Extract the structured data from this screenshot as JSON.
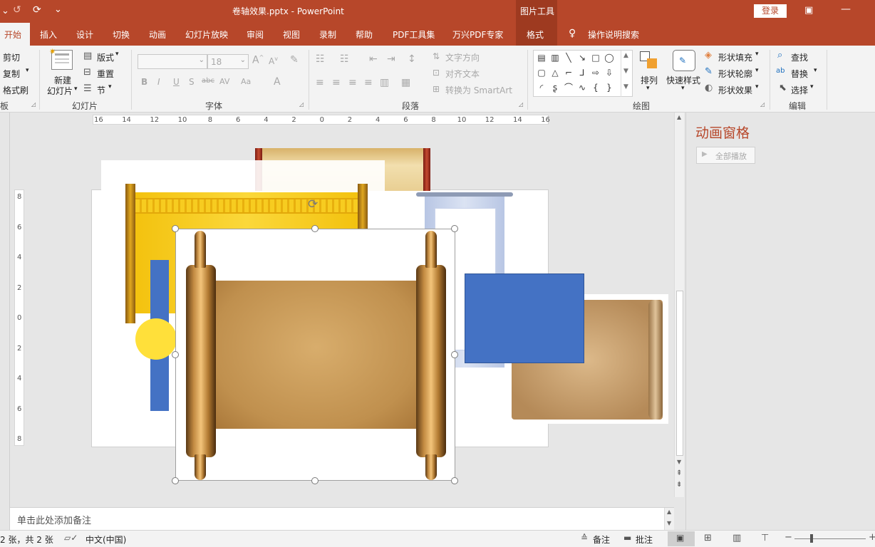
{
  "titlebar": {
    "quick_access": [
      "↺",
      "⟳",
      "⌄"
    ],
    "title": "卷轴效果.pptx  -  PowerPoint",
    "context_tab": "图片工具",
    "login": "登录"
  },
  "tabs": [
    "开始",
    "插入",
    "设计",
    "切换",
    "动画",
    "幻灯片放映",
    "审阅",
    "视图",
    "录制",
    "帮助",
    "PDF工具集",
    "万兴PDF专家",
    "格式"
  ],
  "tell_me": "操作说明搜索",
  "clipboard": {
    "cut": "剪切",
    "copy": "复制",
    "format_painter": "格式刷",
    "group_partial": "板"
  },
  "slides_group": {
    "new_slide": "新建",
    "new_slide2": "幻灯片",
    "layout": "版式",
    "reset": "重置",
    "section": "节",
    "title": "幻灯片"
  },
  "font_group": {
    "size": "18",
    "title": "字体",
    "bold": "B",
    "italic": "I",
    "underline": "U",
    "shadow": "S",
    "strike": "abc",
    "spacing": "AV",
    "case": "Aa",
    "color": "A"
  },
  "paragraph_group": {
    "text_direction": "文字方向",
    "align_text": "对齐文本",
    "smartart": "转换为 SmartArt",
    "title": "段落"
  },
  "drawing_group": {
    "arrange": "排列",
    "quick_styles": "快速样式",
    "shape_fill": "形状填充",
    "shape_outline": "形状轮廓",
    "shape_effects": "形状效果",
    "title": "绘图"
  },
  "editing_group": {
    "find": "查找",
    "replace": "替换",
    "select": "选择",
    "title": "编辑"
  },
  "ruler": {
    "labels": [
      "16",
      "14",
      "12",
      "10",
      "8",
      "6",
      "4",
      "2",
      "0",
      "2",
      "4",
      "6",
      "8",
      "10",
      "12",
      "14",
      "16"
    ]
  },
  "vruler": {
    "labels": [
      "8",
      "6",
      "4",
      "2",
      "0",
      "2",
      "4",
      "6",
      "8"
    ]
  },
  "notes": {
    "placeholder": "单击此处添加备注"
  },
  "status": {
    "slide_info": "2 张，共 2 张",
    "language": "中文(中国)",
    "notes": "备注",
    "comments": "批注"
  },
  "anim_pane": {
    "title": "动画窗格",
    "play_all": "全部播放"
  },
  "colors": {
    "accent": "#b7472a",
    "blue_shape": "#4472c4",
    "yellow_circle": "#ffe03a"
  }
}
